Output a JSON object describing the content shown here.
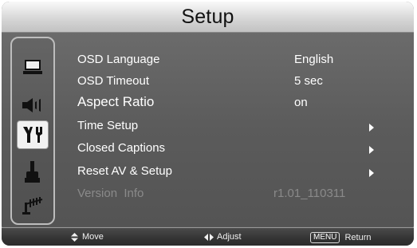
{
  "header": {
    "title": "Setup"
  },
  "sidebar": {
    "icons": [
      {
        "name": "monitor-icon",
        "selected": false
      },
      {
        "name": "speaker-icon",
        "selected": false
      },
      {
        "name": "setup-tools-icon",
        "selected": true
      },
      {
        "name": "plug-icon",
        "selected": false
      },
      {
        "name": "antenna-icon",
        "selected": false
      }
    ]
  },
  "menu": {
    "items": [
      {
        "label": "OSD Language",
        "value": "English"
      },
      {
        "label": "OSD Timeout",
        "value": "5 sec"
      },
      {
        "label": "Aspect Ratio",
        "value": "on"
      },
      {
        "label": "Time Setup"
      },
      {
        "label": "Closed Captions"
      },
      {
        "label": "Reset AV & Setup"
      },
      {
        "label": "Version  Info",
        "value": "r1.01_110311"
      }
    ]
  },
  "footer": {
    "move_label": "Move",
    "adjust_label": "Adjust",
    "menu_key": "MENU",
    "return_label": "Return"
  },
  "colors": {
    "accent": "#ffffff",
    "background": "#5b5b5b",
    "disabled": "#8a8a8a"
  }
}
